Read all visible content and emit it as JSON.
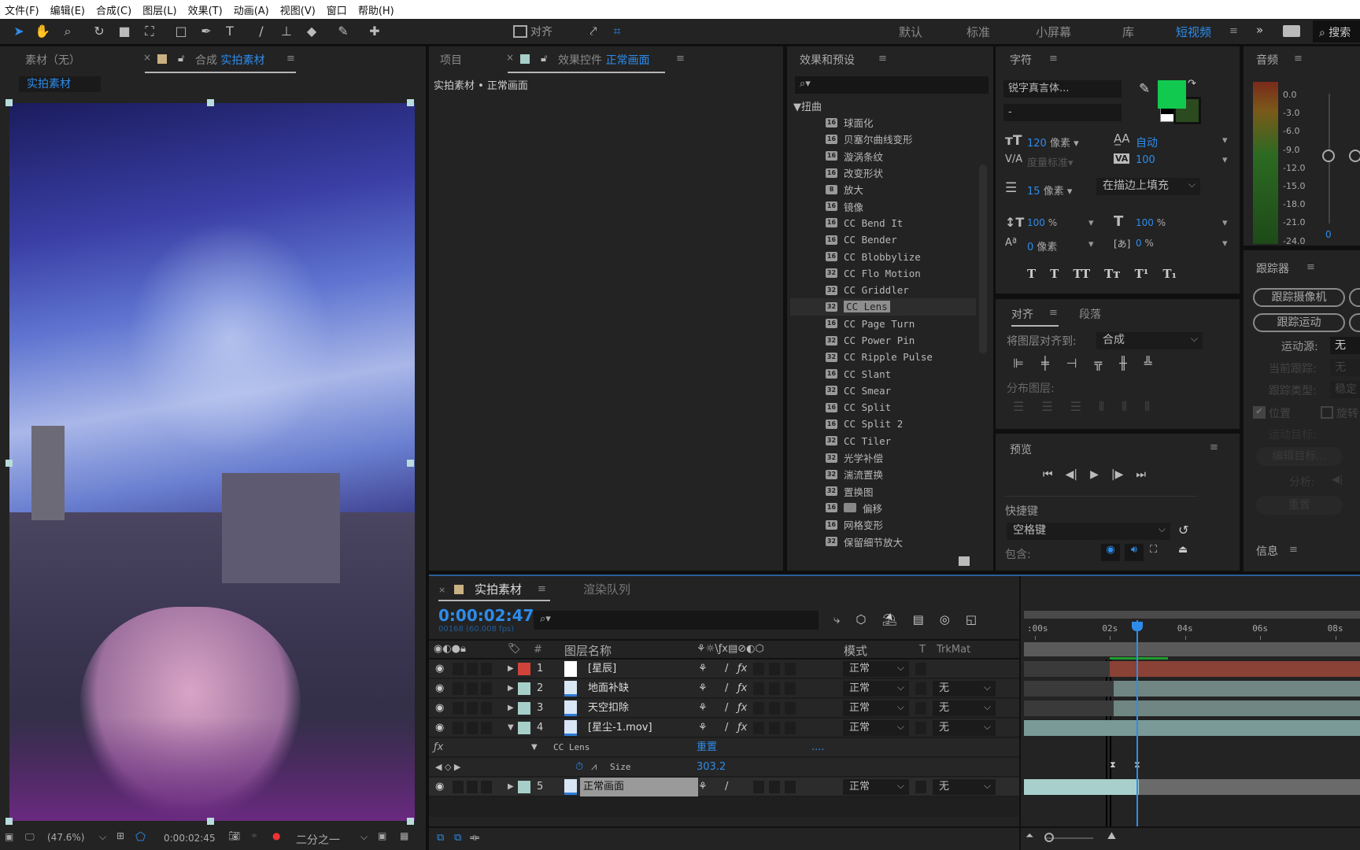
{
  "menu": {
    "items": [
      "文件(F)",
      "编辑(E)",
      "合成(C)",
      "图层(L)",
      "效果(T)",
      "动画(A)",
      "视图(V)",
      "窗口",
      "帮助(H)"
    ]
  },
  "toolbar": {
    "align_label": "对齐",
    "workspaces": [
      "默认",
      "标准",
      "小屏幕",
      "库",
      "短视频"
    ],
    "active_workspace": "短视频",
    "more": "»",
    "search_label": "搜索"
  },
  "comp_panel": {
    "footage_tab": "素材（无）",
    "comp_prefix": "合成",
    "comp_name": "实拍素材",
    "breadcrumb": "实拍素材",
    "footer": {
      "zoom": "(47.6%)",
      "time": "0:00:02:45",
      "resolution": "二分之一"
    }
  },
  "effect_controls": {
    "project_tab": "项目",
    "prefix": "效果控件",
    "layer": "正常画面",
    "breadcrumb": "实拍素材 • 正常画面"
  },
  "effects_presets": {
    "title": "效果和预设",
    "category": "扭曲",
    "items": [
      {
        "badge": "16",
        "name": "球面化"
      },
      {
        "badge": "16",
        "name": "贝塞尔曲线变形"
      },
      {
        "badge": "16",
        "name": "漩涡条纹"
      },
      {
        "badge": "16",
        "name": "改变形状"
      },
      {
        "badge": "8",
        "name": "放大"
      },
      {
        "badge": "16",
        "name": "镜像"
      },
      {
        "badge": "16",
        "name": "CC Bend It"
      },
      {
        "badge": "16",
        "name": "CC Bender"
      },
      {
        "badge": "16",
        "name": "CC Blobbylize"
      },
      {
        "badge": "32",
        "name": "CC Flo Motion"
      },
      {
        "badge": "32",
        "name": "CC Griddler"
      },
      {
        "badge": "32",
        "name": "CC Lens",
        "selected": true
      },
      {
        "badge": "16",
        "name": "CC Page Turn"
      },
      {
        "badge": "32",
        "name": "CC Power Pin"
      },
      {
        "badge": "32",
        "name": "CC Ripple Pulse"
      },
      {
        "badge": "16",
        "name": "CC Slant"
      },
      {
        "badge": "32",
        "name": "CC Smear"
      },
      {
        "badge": "16",
        "name": "CC Split"
      },
      {
        "badge": "16",
        "name": "CC Split 2"
      },
      {
        "badge": "32",
        "name": "CC Tiler"
      },
      {
        "badge": "32",
        "name": "光学补偿"
      },
      {
        "badge": "32",
        "name": "湍流置换"
      },
      {
        "badge": "32",
        "name": "置换图"
      },
      {
        "badge": "16",
        "name": "偏移"
      },
      {
        "badge": "16",
        "name": "网格变形"
      },
      {
        "badge": "32",
        "name": "保留细节放大"
      }
    ]
  },
  "character": {
    "title": "字符",
    "font": "锐字真言体...",
    "style": "-",
    "size": "120",
    "size_unit": "像素",
    "leading": "自动",
    "kerning": "度量标准",
    "tracking": "100",
    "stroke": "15",
    "stroke_unit": "像素",
    "stroke_mode": "在描边上填充",
    "vscale": "100",
    "hscale": "100",
    "pct": "%",
    "baseline": "0",
    "baseline_unit": "像素",
    "tsume": "0",
    "fill_color": "#12c94f",
    "stroke_color": "#2b4a1f",
    "styles": [
      "T",
      "T",
      "TT",
      "Tт",
      "T¹",
      "T₁"
    ]
  },
  "align": {
    "tab_align": "对齐",
    "tab_paragraph": "段落",
    "align_to_label": "将图层对齐到:",
    "align_to": "合成",
    "distribute_label": "分布图层:"
  },
  "preview": {
    "title": "预览",
    "shortcut_label": "快捷键",
    "shortcut": "空格键",
    "include_label": "包含:"
  },
  "audio": {
    "title": "音频",
    "scale": [
      "0.0",
      "-3.0",
      "-6.0",
      "-9.0",
      "-12.0",
      "-15.0",
      "-18.0",
      "-21.0",
      "-24.0"
    ],
    "value": "0"
  },
  "tracker": {
    "title": "跟踪器",
    "track_camera": "跟踪摄像机",
    "track_motion": "跟踪运动",
    "motion_source_label": "运动源:",
    "motion_source": "无",
    "current_track_label": "当前跟踪:",
    "current_track": "无",
    "track_type_label": "跟踪类型:",
    "track_type": "稳定",
    "position": "位置",
    "rotation": "旋转",
    "motion_target_label": "运动目标:",
    "edit_target": "编辑目标...",
    "analyze_label": "分析:",
    "reset": "重置"
  },
  "info": {
    "title": "信息"
  },
  "timeline": {
    "comp_tab": "实拍素材",
    "render_tab": "渲染队列",
    "timecode": "0:00:02:47",
    "frame_info": "00168 (60.008 fps)",
    "columns": {
      "num": "#",
      "name": "图层名称",
      "mode": "模式",
      "t": "T",
      "trkmat": "TrkMat"
    },
    "layers": [
      {
        "num": "1",
        "name": "[星辰]",
        "label_color": "#d0433a",
        "mode": "正常",
        "trkmat": ""
      },
      {
        "num": "2",
        "name": "地面补缺",
        "label_color": "#a7cfc9",
        "mode": "正常",
        "trkmat": "无"
      },
      {
        "num": "3",
        "name": "天空扣除",
        "label_color": "#a7cfc9",
        "mode": "正常",
        "trkmat": "无"
      },
      {
        "num": "4",
        "name": "[星尘-1.mov]",
        "label_color": "#a7cfc9",
        "mode": "正常",
        "trkmat": "无",
        "expanded": true
      },
      {
        "num": "5",
        "name": "正常画面",
        "label_color": "#a7cfc9",
        "mode": "正常",
        "trkmat": "无",
        "selected": true
      }
    ],
    "effect": {
      "name": "CC Lens",
      "reset": "重置",
      "dots": "....",
      "property": "Size",
      "value": "303.2"
    },
    "ruler": [
      ":00s",
      "02s",
      "04s",
      "06s",
      "08s"
    ],
    "playhead_seconds": 2.78
  }
}
